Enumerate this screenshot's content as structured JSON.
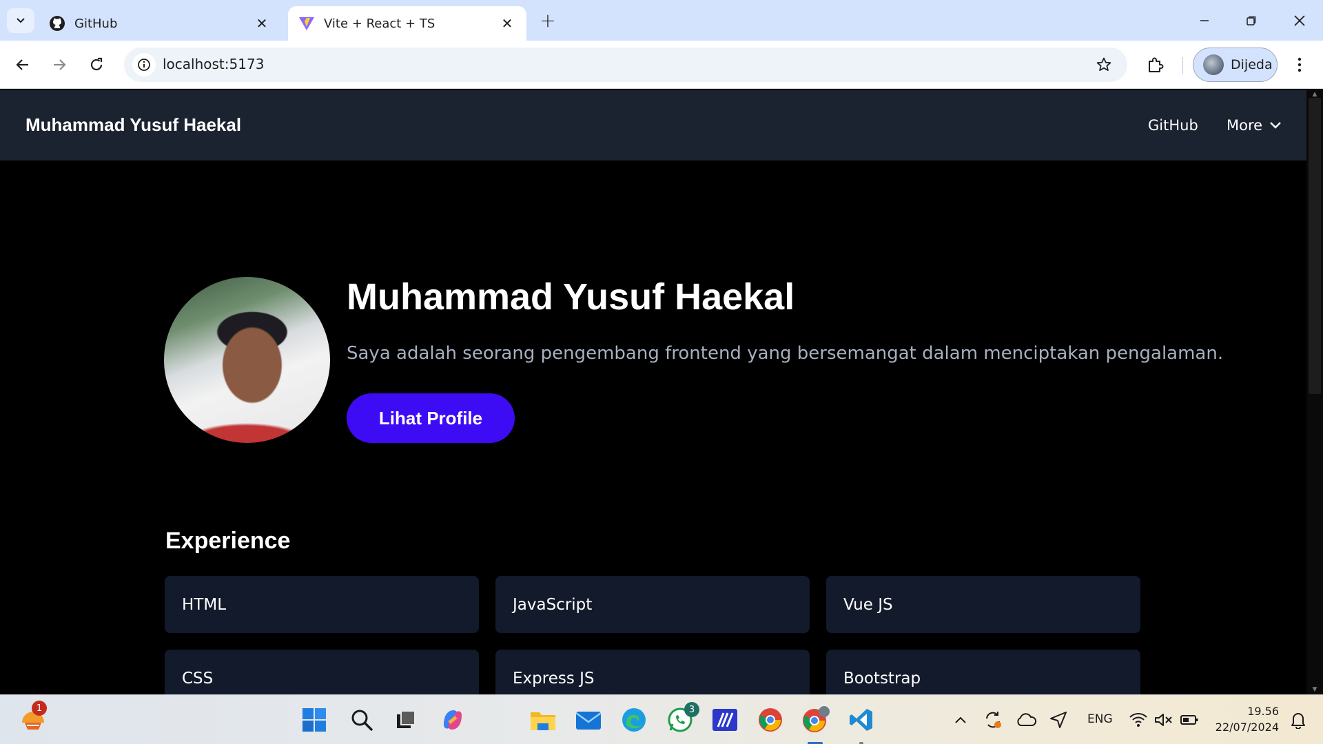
{
  "browser": {
    "tabs": [
      {
        "title": "GitHub",
        "icon": "github-icon",
        "active": false
      },
      {
        "title": "Vite + React + TS",
        "icon": "vite-icon",
        "active": true
      }
    ],
    "url": "localhost:5173",
    "profile_name": "Dijeda"
  },
  "site": {
    "brand": "Muhammad Yusuf Haekal",
    "nav": {
      "github": "GitHub",
      "more": "More"
    },
    "hero": {
      "name": "Muhammad Yusuf Haekal",
      "description": "Saya adalah seorang pengembang frontend yang bersemangat dalam menciptakan pengalaman.",
      "button": "Lihat Profile"
    },
    "experience": {
      "title": "Experience",
      "items": [
        "HTML",
        "JavaScript",
        "Vue JS",
        "CSS",
        "Express JS",
        "Bootstrap"
      ]
    },
    "colors": {
      "navbar": "#1b2230",
      "accent_button": "#3d0cf5",
      "card": "#121a2c",
      "description": "#a7b0bf"
    }
  },
  "taskbar": {
    "badges": {
      "widgets": "1",
      "whatsapp": "3"
    },
    "language": "ENG",
    "time": "19.56",
    "date": "22/07/2024"
  }
}
